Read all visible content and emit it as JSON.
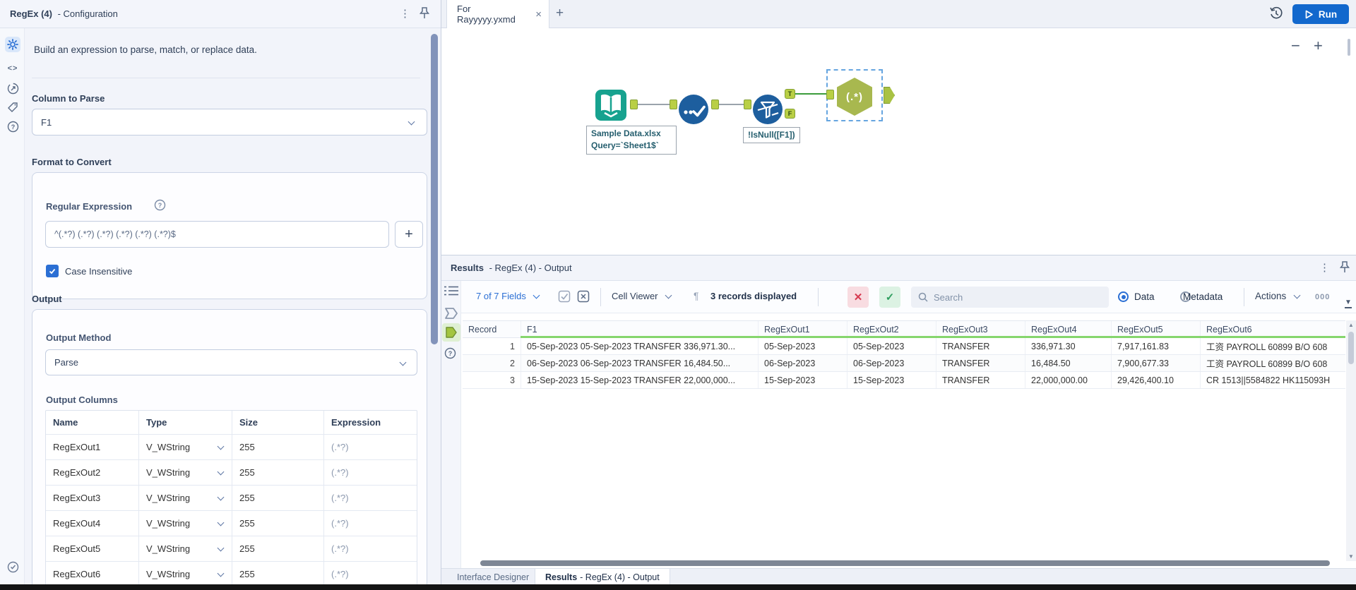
{
  "config_panel": {
    "title_bold": "RegEx (4)",
    "title_rest": "- Configuration",
    "description": "Build an expression to parse, match, or replace data.",
    "column_to_parse_label": "Column to Parse",
    "column_to_parse_value": "F1",
    "format_to_convert_label": "Format to Convert",
    "regular_expression_label": "Regular Expression",
    "regular_expression_value": "^(.*?) (.*?) (.*?) (.*?) (.*?) (.*?)$",
    "add_button_label": "+",
    "case_insensitive_label": "Case Insensitive",
    "output_label": "Output",
    "output_method_label": "Output Method",
    "output_method_value": "Parse",
    "output_columns_label": "Output Columns",
    "output_columns_headers": [
      "Name",
      "Type",
      "Size",
      "Expression"
    ],
    "output_columns_rows": [
      {
        "name": "RegExOut1",
        "type": "V_WString",
        "size": "255",
        "expression": "(.*?)"
      },
      {
        "name": "RegExOut2",
        "type": "V_WString",
        "size": "255",
        "expression": "(.*?)"
      },
      {
        "name": "RegExOut3",
        "type": "V_WString",
        "size": "255",
        "expression": "(.*?)"
      },
      {
        "name": "RegExOut4",
        "type": "V_WString",
        "size": "255",
        "expression": "(.*?)"
      },
      {
        "name": "RegExOut5",
        "type": "V_WString",
        "size": "255",
        "expression": "(.*?)"
      },
      {
        "name": "RegExOut6",
        "type": "V_WString",
        "size": "255",
        "expression": "(.*?)"
      }
    ]
  },
  "document_tab": {
    "title": "For Rayyyyy.yxmd",
    "close_glyph": "×",
    "new_tab_glyph": "+"
  },
  "top_toolbar": {
    "run_label": "Run"
  },
  "canvas": {
    "zoom_out_glyph": "−",
    "zoom_in_glyph": "+",
    "input_tool_annotation_line1": "Sample Data.xlsx",
    "input_tool_annotation_line2": "Query=`Sheet1$`",
    "filter_annotation": "!IsNull([F1])",
    "filter_true_label": "T",
    "filter_false_label": "F",
    "regex_tool_glyph": "(.*)"
  },
  "results_panel": {
    "title_bold": "Results",
    "title_rest": "- RegEx (4) - Output",
    "toolbar": {
      "fields_label": "7 of 7 Fields",
      "cell_viewer_label": "Cell Viewer",
      "paragraph_glyph": "¶",
      "records_label": "3 records displayed",
      "search_placeholder": "Search",
      "data_label": "Data",
      "metadata_label": "Metadata",
      "actions_label": "Actions",
      "counter": "000"
    },
    "table": {
      "headers": [
        "Record",
        "F1",
        "RegExOut1",
        "RegExOut2",
        "RegExOut3",
        "RegExOut4",
        "RegExOut5",
        "RegExOut6"
      ],
      "rows": [
        [
          "1",
          "05-Sep-2023 05-Sep-2023 TRANSFER 336,971.30...",
          "05-Sep-2023",
          "05-Sep-2023",
          "TRANSFER",
          "336,971.30",
          "7,917,161.83",
          "工资 PAYROLL 60899 B/O 608"
        ],
        [
          "2",
          "06-Sep-2023 06-Sep-2023 TRANSFER 16,484.50...",
          "06-Sep-2023",
          "06-Sep-2023",
          "TRANSFER",
          "16,484.50",
          "7,900,677.33",
          "工资 PAYROLL 60899 B/O 608"
        ],
        [
          "3",
          "15-Sep-2023 15-Sep-2023 TRANSFER 22,000,000...",
          "15-Sep-2023",
          "15-Sep-2023",
          "TRANSFER",
          "22,000,000.00",
          "29,426,400.10",
          "CR 1513||5584822 HK115093H"
        ]
      ]
    },
    "bottom_tabs": {
      "interface_designer": "Interface Designer",
      "results_bold": "Results",
      "results_rest": "- RegEx (4) - Output"
    }
  },
  "colors": {
    "accent_blue": "#2b6fd4",
    "run_blue": "#1268cd",
    "tool_blue": "#1d5e9e",
    "input_tool_teal": "#17a28f",
    "regex_tool_olive": "#a8b84f",
    "anchor_green": "#b9cf45",
    "connector_green": "#3c9c3c",
    "header_underline_green": "#86d66d",
    "error_red": "#d6394f",
    "success_green": "#2f9e5f"
  }
}
